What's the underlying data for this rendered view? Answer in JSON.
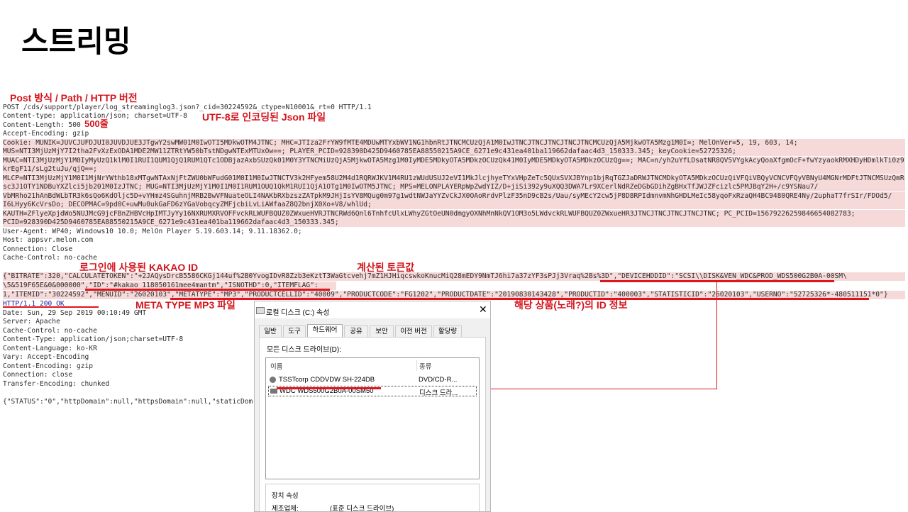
{
  "title": "스트리밍",
  "request_lines": [
    "POST /cds/support/player/log_streaminglog3.json?_cid=30224592&_ctype=N10001&_rt=0 HTTP/1.1",
    "Content-type: application/json; charset=UTF-8",
    "Content-Length: 500",
    "Accept-Encoding: gzip",
    "Cookie: MUNIK=JUVCJUFDJUI0JUVDJUE3JTgwY2swMW01M0IwOTI5MDkwOTM4JTNC; MHC=JTIza2FrYW9fMTE4MDUwMTYxbWV1NG1hbnRtJTNCMCUzQjA1M0IwJTNCJTNCJTNCJTNCJTNCMCUzQjA5MjkwOTA5Mzg1M0I=; MelOnVer=5, 19, 603, 14;",
    "MUS=NTI3MjUzMjY7I2tha2FvXzExODA1MDE2MW11ZTRtYW50bTstNDgwNTExMTUxOw==; PLAYER_PCID=928390D425D9460785EA88550215A9CE_6271e9c431ea401ba119662dafaac4d3_150333.345; keyCookie=52725326;",
    "MUAC=NTI3MjUzMjY1M0IyMyUzQ1klM0I1RUI1QUM1QjQ1RUM1QTc1ODBjazAxbSUzQk01M0Y3YTNCMiUzQjA5MjkwOTA5Mzg1M0IyMDE5MDkyOTA5MDkzOCUzQk41M0IyMDE5MDkyOTA5MDkzOCUzQg==; MAC=n/yh2uYfLDsatNR8QV5VYgkAcyQoaXfgmOcF+fwYzyaokRMXHDyHDmlkTi0z91zI6/",
    "krEgF11/sLg2tuJu/qjQ==;",
    "MLCP=NTI3MjUzMjY1M0I1MjNrYWthb18xMTgwNTAxNjFtZWU0bWFudG01M0I1M0IwJTNCTV3k2HFyem58U2M4d1RQRWJKV1M4RU1zWUdUSUJ2eVI1MkJlcjhyeTYxVHpZeTc5QUxSVXJBYnp1bjRqTGZJaDRWJTNCMDkyOTA5MDkzOCUzQiVFQiVBQyVCNCVFQyVBNyU4MGNrMDFtJTNCMSUzQmRsYXl",
    "sc3J1OTY1NDBuYXZlci5jb201M0IzJTNC; MUG=NTI3MjUzMjY1M0I1M0I1RUM1OUQ1QkM1RUI1QjA1OTg1M0IwOTM5JTNC; MPS=MELONPLAYERpWpZwdYIZ/D+jiSi392y9uXQQ3DWA7Lr9XCerlNdRZeDGbGDihZgBHxTfJWJZFcizlc5PMJBqY2H+/c9YSNau7/",
    "VbMRho21hAnBdWLbTR3k6sQo6KdOljc5D+vYHmz4SGuhnjMRB2BwVFNuateOLI4NAKbRXbzszZATpkM9JHjIsYV8MQug0m97g1wdtNWJaYYZvCkJX0OAoRrdvPlzF35nD9cB2s/Uau/syMEcY2cw5jP8D8RPIdmnvmNhGHDLMeIc58yqoFxRzaQH4BC9480QRE4Ny/2uphaT7frSIr/FDOd5/",
    "I6LHyy6KcVrsDo; DECOPMAC=9pd0C+uwMu0ukGaFD6zYGaVobqcyZMFjcbiLvLiAWfaaZ8Q2bnjX0Xo+V8/whlUd;",
    "KAUTH=ZFlyeXpjdWo5NUJMcG9jcFBnZHBVcHpIMTJyYy16NXRUMXRVOFFvckRLWUFBQUZ0ZWxueHVRJTNCRWd6Qnl6TnhfcUlxLWhyZGtOeUN0dmgyOXNhMnNkQV1OM3o5LWdvckRLWUFBQUZ0ZWxueHR3JTNCJTNCJTNCJTNCJTNC; PC_PCID=15679226259846654082783;",
    "PCID=928390D425D9460785EA88550215A9CE_6271e9c431ea401ba119662dafaac4d3_150333.345;",
    "User-Agent: WP40; Windows10 10.0; MelOn Player 5.19.603.14; 9.11.18362.0;",
    "Host: appsvr.melon.com",
    "Connection: Close",
    "Cache-Control: no-cache"
  ],
  "body_lines": [
    "{\"BITRATE\":320,\"CALCULATETOKEN\":\"+2JAQysDrcB5586CKGj144uf%2B0YvogIDvR8Zzb3eKztT3WaGtcvehj7mZ1HJHiqcswkoKnucMiQ28mEDY9NmTJ6hi7a37zYF3sPJj3Vraq%2Bs%3D\",\"DEVICEHDDID\":\"SCSI\\\\DISK&VEN_WDC&PROD_WDS500G2B0A-00SM\\",
    "\\5&519F65E&0&000000\",\"ID\":\"#kakao_118050161mee4mantm\",\"ISNOTHD\":0,\"ITEMFLAG\":",
    "1,\"ITEMID\":\"30224592\",\"MENUID\":\"26020103\",\"METATYPE\":\"MP3\",\"PRODUCTCELLID\":\"40009\",\"PRODUCTCODE\":\"FG1202\",\"PRODUCTDATE\":\"20190830143428\",\"PRODUCTID\":\"400003\",\"STATISTICID\":\"26020103\",\"USERNO\":\"52725326*-480511151*0\"}"
  ],
  "response_lines": [
    "HTTP/1.1 200 OK",
    "Date: Sun, 29 Sep 2019 00:10:49 GMT",
    "Server: Apache",
    "Cache-Control: no-cache",
    "Content-Type: application/json;charset=UTF-8",
    "Content-Language: ko-KR",
    "Vary: Accept-Encoding",
    "Content-Encoding: gzip",
    "Connection: close",
    "Transfer-Encoding: chunked"
  ],
  "response_body": "{\"STATUS\":\"0\",\"httpDomain\":null,\"httpsDomain\":null,\"staticDomai",
  "annotations": {
    "post_path": "Post 방식 / Path / HTTP 버전",
    "utf8": "UTF-8로 인코딩된 Json 파일",
    "len500": "500줄",
    "kakao_id": "로그인에 사용된 KAKAO ID",
    "token": "계산된 토큰값",
    "metatype": "META TYPE MP3 파일",
    "product_id": "해당 상품(노래?)의 ID 정보"
  },
  "dialog": {
    "title": "로컬 디스크 (C:) 속성",
    "close": "✕",
    "tabs": [
      "일반",
      "도구",
      "하드웨어",
      "공유",
      "보안",
      "이전 버전",
      "할당량"
    ],
    "active_tab": "하드웨어",
    "all_drives_label": "모든 디스크 드라이브(D):",
    "col_name": "이름",
    "col_type": "종류",
    "rows": [
      {
        "name": "TSSTcorp CDDVDW SH-224DB",
        "type": "DVD/CD-R..."
      },
      {
        "name": "WDC WDS500G2B0A-00SM50",
        "type": "디스크 드라..."
      }
    ],
    "device_props_label": "장치 속성",
    "manufacturer_key": "제조업체:",
    "manufacturer_val": "(표준 디스크 드라이브)"
  }
}
